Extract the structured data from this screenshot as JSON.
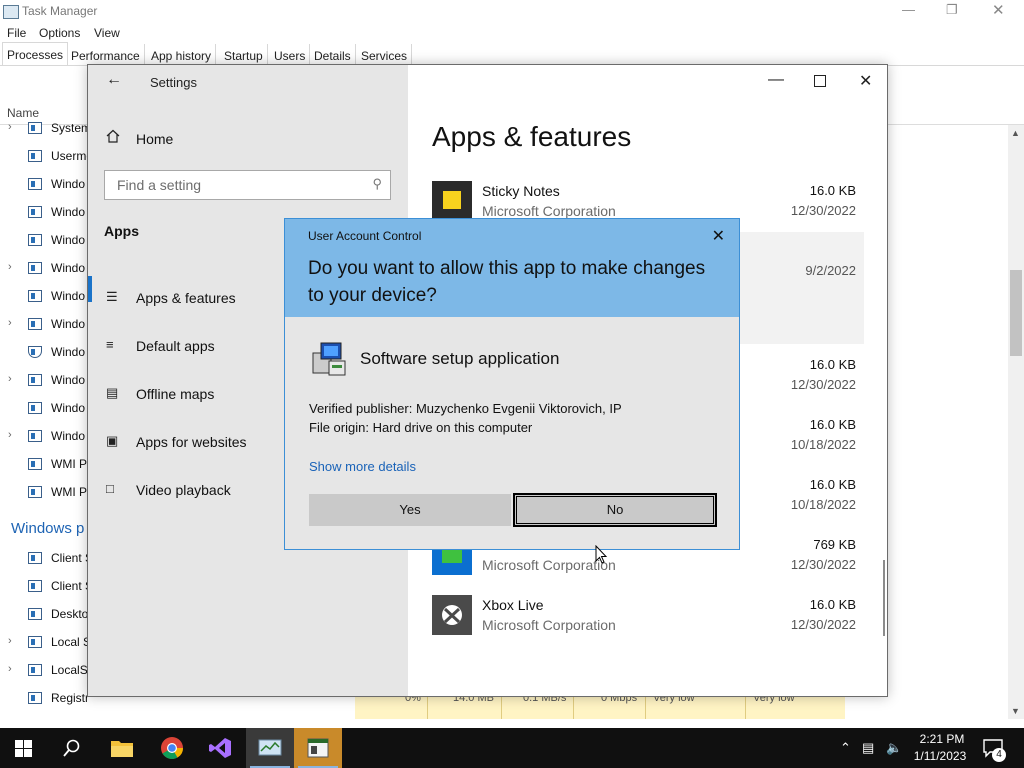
{
  "task_manager": {
    "title": "Task Manager",
    "menu": [
      "File",
      "Options",
      "View"
    ],
    "tabs": [
      "Processes",
      "Performance",
      "App history",
      "Startup",
      "Users",
      "Details",
      "Services"
    ],
    "column_name": "Name",
    "rows": [
      "System",
      "Usermo",
      "Windo",
      "Windo",
      "Windo",
      "Windo",
      "Windo",
      "Windo",
      "Windo",
      "Windo",
      "Windo",
      "Windo",
      "WMI P",
      "WMI P"
    ],
    "group_windows": "Windows p",
    "rows2": [
      "Client S",
      "Client S",
      "Deskto",
      "Local S",
      "LocalSe",
      "Registry"
    ],
    "footer_values": [
      "0%",
      "14.0 MB",
      "0.1 MB/s",
      "0 Mbps",
      "Very low",
      "Very low"
    ]
  },
  "settings": {
    "title": "Settings",
    "home": "Home",
    "search_placeholder": "Find a setting",
    "section": "Apps",
    "nav": [
      "Apps & features",
      "Default apps",
      "Offline maps",
      "Apps for websites",
      "Video playback"
    ],
    "heading": "Apps & features",
    "apps": [
      {
        "name": "Sticky Notes",
        "publisher": "Microsoft Corporation",
        "size": "16.0 KB",
        "date": "12/30/2022"
      },
      {
        "name": "",
        "publisher": "",
        "size": "",
        "date": "9/2/2022"
      },
      {
        "name": "",
        "publisher": "",
        "size": "16.0 KB",
        "date": "12/30/2022"
      },
      {
        "name": "",
        "publisher": "",
        "size": "16.0 KB",
        "date": "10/18/2022"
      },
      {
        "name": "",
        "publisher": "",
        "size": "16.0 KB",
        "date": "10/18/2022"
      },
      {
        "name": "",
        "publisher": "Microsoft Corporation",
        "size": "769 KB",
        "date": "12/30/2022"
      },
      {
        "name": "Xbox Live",
        "publisher": "Microsoft Corporation",
        "size": "16.0 KB",
        "date": "12/30/2022"
      }
    ]
  },
  "uac": {
    "caption": "User Account Control",
    "question": "Do you want to allow this app to make changes to your device?",
    "app_name": "Software setup application",
    "publisher": "Verified publisher: Muzychenko Evgenii Viktorovich, IP",
    "origin": "File origin: Hard drive on this computer",
    "details_link": "Show more details",
    "yes": "Yes",
    "no": "No"
  },
  "taskbar": {
    "time": "2:21 PM",
    "date": "1/11/2023",
    "notification_count": "4"
  }
}
